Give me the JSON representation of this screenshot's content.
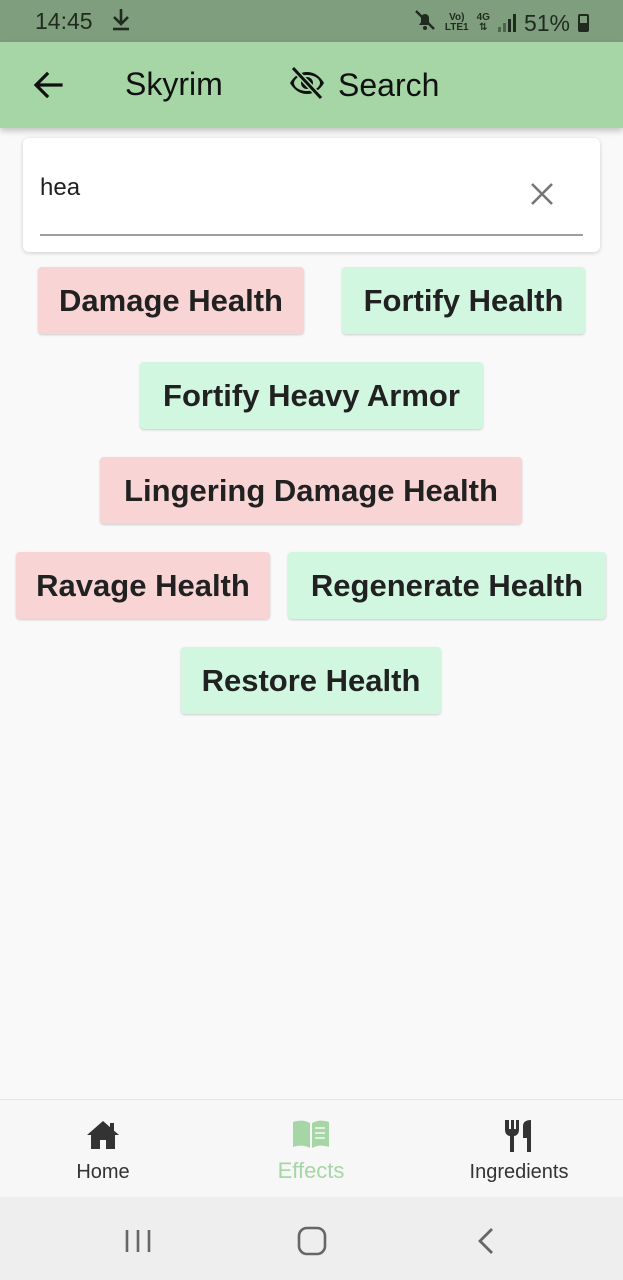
{
  "status_bar": {
    "time": "14:45",
    "volte": "Vo)",
    "lte": "LTE1",
    "network": "4G",
    "battery": "51%"
  },
  "app_bar": {
    "title": "Skyrim",
    "search_label": "Search",
    "background": "#a6d6a5"
  },
  "search": {
    "value": "hea",
    "placeholder": ""
  },
  "effects": [
    {
      "label": "Damage Health",
      "kind": "negative"
    },
    {
      "label": "Fortify Health",
      "kind": "positive"
    },
    {
      "label": "Fortify Heavy Armor",
      "kind": "positive"
    },
    {
      "label": "Lingering Damage Health",
      "kind": "negative"
    },
    {
      "label": "Ravage Health",
      "kind": "negative"
    },
    {
      "label": "Regenerate Health",
      "kind": "positive"
    },
    {
      "label": "Restore Health",
      "kind": "positive"
    }
  ],
  "colors": {
    "negative_chip": "#f8d4d4",
    "positive_chip": "#d2f7e1",
    "accent": "#a6d6a5"
  },
  "bottom_nav": {
    "items": [
      {
        "label": "Home",
        "icon": "home-icon"
      },
      {
        "label": "Effects",
        "icon": "book-icon",
        "active": true
      },
      {
        "label": "Ingredients",
        "icon": "cutlery-icon"
      }
    ]
  },
  "system_nav": {
    "icons": [
      "recents-icon",
      "home-circle-icon",
      "back-chevron-icon"
    ]
  }
}
